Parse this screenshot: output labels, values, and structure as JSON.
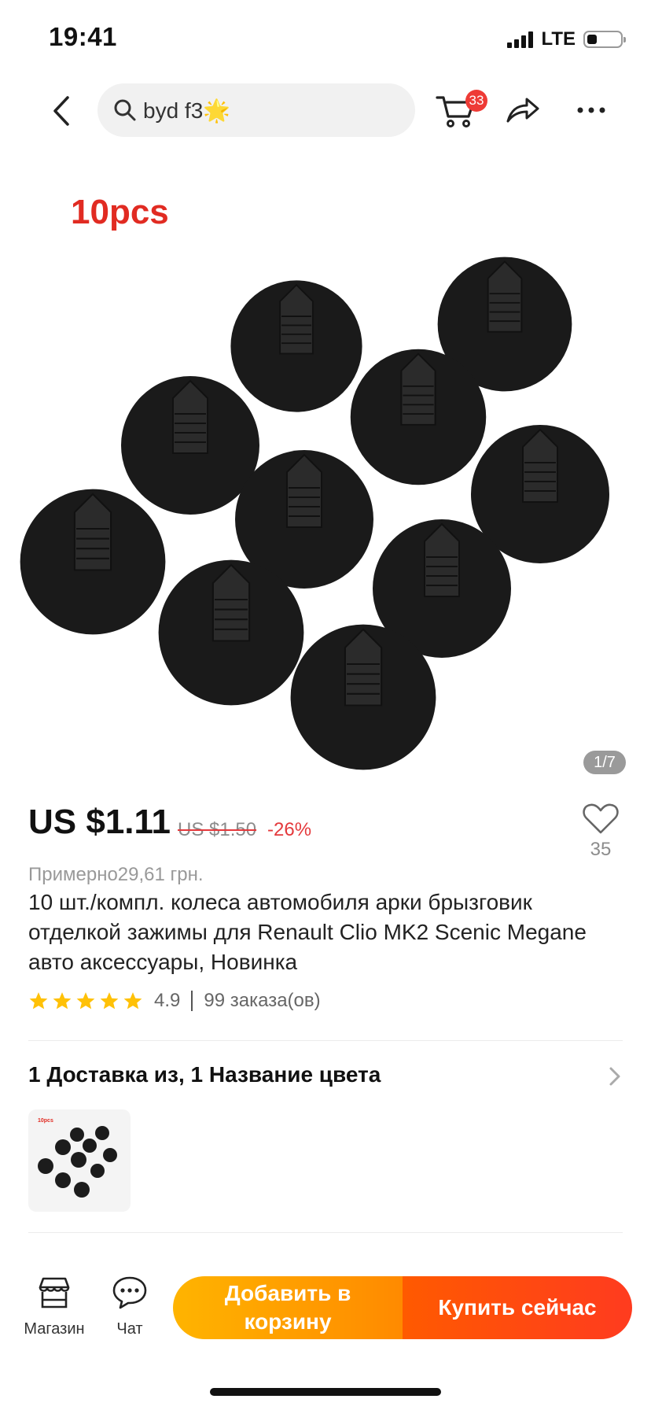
{
  "status_bar": {
    "time": "19:41",
    "network": "LTE",
    "battery_level": 0.3
  },
  "header": {
    "search_query": "byd f3🌟",
    "cart_count": "33",
    "icons": [
      "back-icon",
      "search-icon",
      "cart-icon",
      "share-icon",
      "more-icon"
    ]
  },
  "gallery": {
    "label": "10pcs",
    "counter": "1/7"
  },
  "product": {
    "price": "US $1.11",
    "old_price": "US $1.50",
    "discount": "-26%",
    "approx_price": "Примерно29,61 грн.",
    "wish_count": "35",
    "title": "10 шт./компл. колеса автомобиля арки брызговик отделкой зажимы для Renault Clio MK2 Scenic Megane авто аксессуары, Новинка",
    "rating": "4.9",
    "stars": 5,
    "orders": "99 заказа(ов)"
  },
  "delivery": {
    "label": "1 Доставка из, 1 Название цвета",
    "thumb_label": "10pcs"
  },
  "bottom_bar": {
    "store_label": "Магазин",
    "chat_label": "Чат",
    "add_to_cart_label": "Добавить в корзину",
    "buy_now_label": "Купить сейчас"
  },
  "colors": {
    "accent_red": "#e4393c",
    "add_to_cart_orange": "#ffb400",
    "buy_now_red": "#ff3b1f",
    "star_yellow": "#ffc107"
  }
}
